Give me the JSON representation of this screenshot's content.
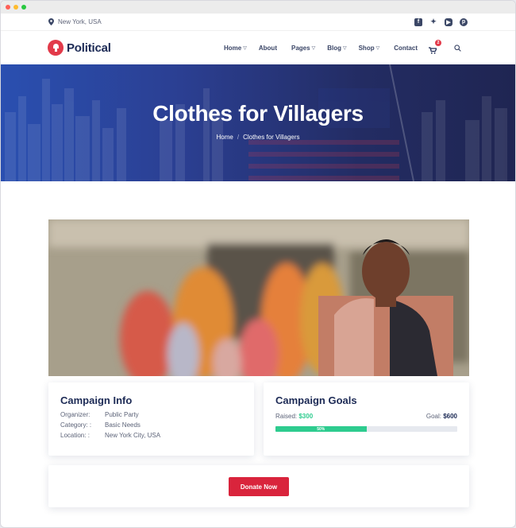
{
  "window": {
    "dots": [
      "#ff5f57",
      "#febc2e",
      "#28c840"
    ]
  },
  "topbar": {
    "location": "New York, USA",
    "social": [
      "facebook-icon",
      "twitter-icon",
      "youtube-icon",
      "pinterest-icon"
    ]
  },
  "nav": {
    "logo_text": "Political",
    "items": [
      {
        "label": "Home",
        "dropdown": true
      },
      {
        "label": "About",
        "dropdown": false
      },
      {
        "label": "Pages",
        "dropdown": true
      },
      {
        "label": "Blog",
        "dropdown": true
      },
      {
        "label": "Shop",
        "dropdown": true
      },
      {
        "label": "Contact",
        "dropdown": false
      }
    ],
    "cart_count": "2"
  },
  "hero": {
    "title": "Clothes for Villagers",
    "breadcrumb_home": "Home",
    "breadcrumb_sep": "/",
    "breadcrumb_current": "Clothes for Villagers"
  },
  "campaign_info": {
    "title": "Campaign Info",
    "rows": [
      {
        "key": "Organizer:",
        "value": "Public Party"
      },
      {
        "key": "Category: :",
        "value": "Basic Needs"
      },
      {
        "key": "Location: :",
        "value": "New York City, USA"
      }
    ]
  },
  "campaign_goals": {
    "title": "Campaign Goals",
    "raised_label": "Raised:",
    "raised_value": "$300",
    "goal_label": "Goal:",
    "goal_value": "$600",
    "progress_text": "50%",
    "progress": 0.5
  },
  "donate": {
    "label": "Donate Now"
  },
  "colors": {
    "accent": "#e23a4a",
    "progress": "#2ecc8f",
    "navy": "#1c2a55",
    "button": "#d9243c"
  }
}
